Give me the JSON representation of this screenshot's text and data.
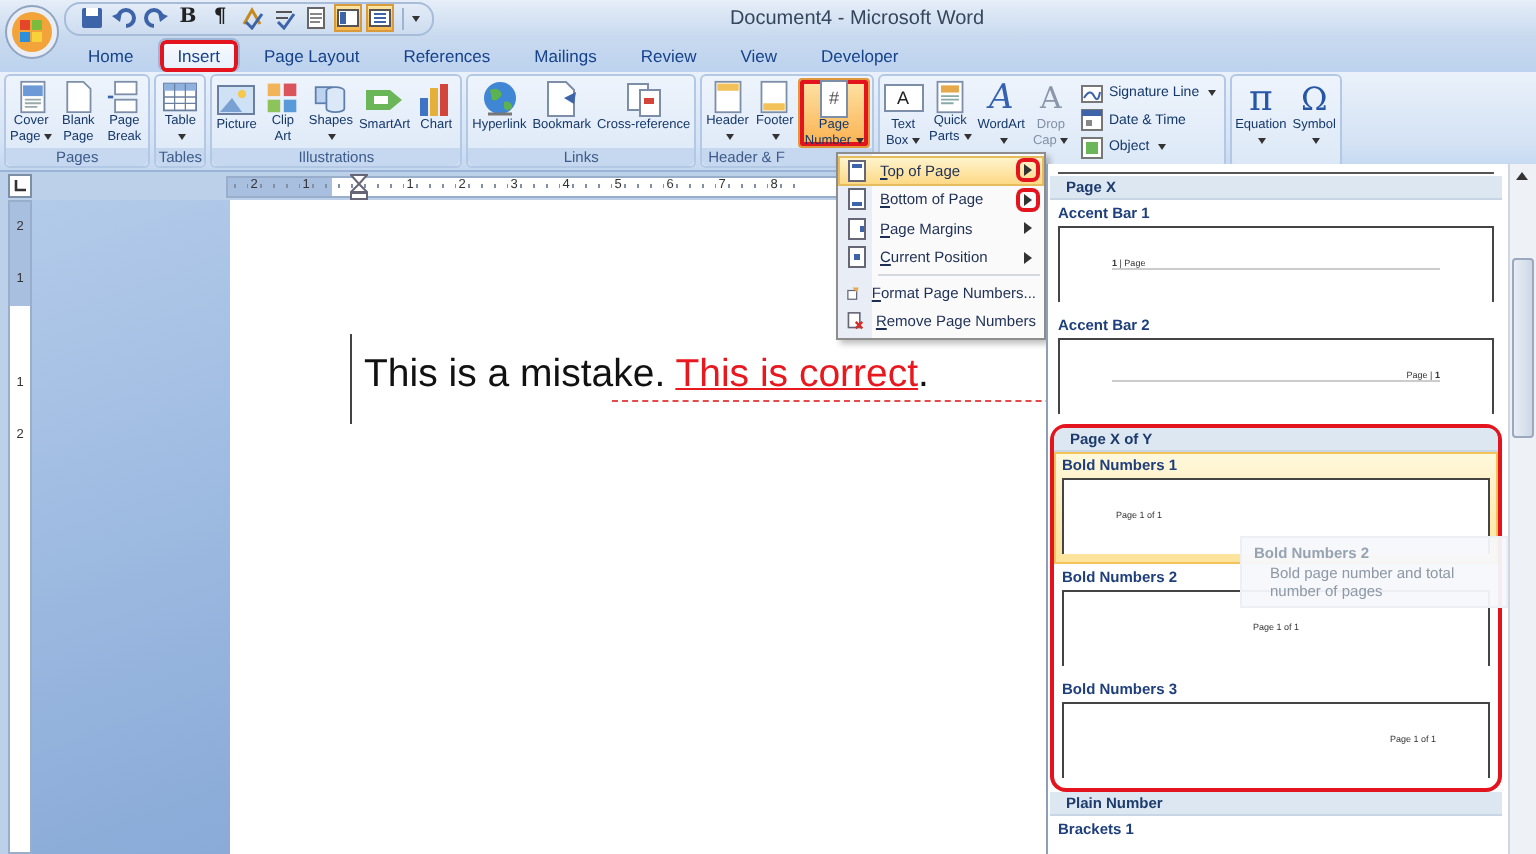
{
  "window": {
    "title": "Document4 - Microsoft Word"
  },
  "quick_access": [
    {
      "pressed": false
    },
    {
      "pressed": false
    },
    {
      "pressed": false
    },
    {
      "glyph": "B",
      "pressed": false
    },
    {
      "glyph": "¶",
      "pressed": false
    },
    {
      "pressed": false
    },
    {
      "pressed": false
    },
    {
      "pressed": false
    },
    {
      "pressed": true
    },
    {
      "pressed": true
    }
  ],
  "tabs": [
    {
      "label": "Home",
      "selected": false,
      "highlighted": false
    },
    {
      "label": "Insert",
      "selected": true,
      "highlighted": true
    },
    {
      "label": "Page Layout",
      "selected": false,
      "highlighted": false
    },
    {
      "label": "References",
      "selected": false,
      "highlighted": false
    },
    {
      "label": "Mailings",
      "selected": false,
      "highlighted": false
    },
    {
      "label": "Review",
      "selected": false,
      "highlighted": false
    },
    {
      "label": "View",
      "selected": false,
      "highlighted": false
    },
    {
      "label": "Developer",
      "selected": false,
      "highlighted": false
    }
  ],
  "ribbon": {
    "groups": [
      {
        "label": "Pages",
        "buttons": [
          {
            "kind": "large",
            "label": "Cover\nPage",
            "dropdown": true,
            "selected": false,
            "disabled": false,
            "highlighted": false
          },
          {
            "kind": "large",
            "label": "Blank\nPage",
            "dropdown": false,
            "selected": false,
            "disabled": false,
            "highlighted": false
          },
          {
            "kind": "large",
            "label": "Page\nBreak",
            "dropdown": false,
            "selected": false,
            "disabled": false,
            "highlighted": false
          }
        ]
      },
      {
        "label": "Tables",
        "buttons": [
          {
            "kind": "large",
            "label": "Table",
            "dropdown": true,
            "selected": false,
            "disabled": false,
            "highlighted": false
          }
        ]
      },
      {
        "label": "Illustrations",
        "buttons": [
          {
            "kind": "large",
            "label": "Picture",
            "dropdown": false,
            "selected": false,
            "disabled": false,
            "highlighted": false
          },
          {
            "kind": "large",
            "label": "Clip\nArt",
            "dropdown": false,
            "selected": false,
            "disabled": false,
            "highlighted": false
          },
          {
            "kind": "large",
            "label": "Shapes",
            "dropdown": true,
            "selected": false,
            "disabled": false,
            "highlighted": false
          },
          {
            "kind": "large",
            "label": "SmartArt",
            "dropdown": false,
            "selected": false,
            "disabled": false,
            "highlighted": false
          },
          {
            "kind": "large",
            "label": "Chart",
            "dropdown": false,
            "selected": false,
            "disabled": false,
            "highlighted": false
          }
        ]
      },
      {
        "label": "Links",
        "buttons": [
          {
            "kind": "large",
            "label": "Hyperlink",
            "dropdown": false,
            "selected": false,
            "disabled": false,
            "highlighted": false
          },
          {
            "kind": "large",
            "label": "Bookmark",
            "dropdown": false,
            "selected": false,
            "disabled": false,
            "highlighted": false
          },
          {
            "kind": "large",
            "label": "Cross-reference",
            "dropdown": false,
            "selected": false,
            "disabled": false,
            "highlighted": false
          }
        ]
      },
      {
        "label": "Header & F",
        "buttons": [
          {
            "kind": "large",
            "label": "Header",
            "dropdown": true,
            "selected": false,
            "disabled": false,
            "highlighted": false
          },
          {
            "kind": "large",
            "label": "Footer",
            "dropdown": true,
            "selected": false,
            "disabled": false,
            "highlighted": false
          },
          {
            "kind": "large",
            "label": "Page\nNumber",
            "glyph": "#",
            "dropdown": true,
            "selected": true,
            "disabled": false,
            "highlighted": true
          }
        ]
      },
      {
        "buttons": [
          {
            "kind": "large",
            "label": "Text\nBox",
            "glyph": "A",
            "dropdown": true,
            "selected": false,
            "disabled": false,
            "highlighted": false
          },
          {
            "kind": "large",
            "label": "Quick\nParts",
            "dropdown": true,
            "selected": false,
            "disabled": false,
            "highlighted": false
          },
          {
            "kind": "large",
            "label": "WordArt",
            "glyph": "A",
            "dropdown": true,
            "selected": false,
            "disabled": false,
            "highlighted": false
          },
          {
            "kind": "large",
            "label": "Drop\nCap",
            "glyph": "A",
            "dropdown": true,
            "selected": false,
            "disabled": true,
            "highlighted": false
          },
          {
            "kind": "small",
            "label": "Signature Line",
            "dropdown": true,
            "selected": false,
            "disabled": false,
            "highlighted": false
          },
          {
            "kind": "small",
            "label": "Date & Time",
            "dropdown": false,
            "selected": false,
            "disabled": false,
            "highlighted": false
          },
          {
            "kind": "small",
            "label": "Object",
            "dropdown": true,
            "selected": false,
            "disabled": false,
            "highlighted": false
          }
        ]
      },
      {
        "buttons": [
          {
            "kind": "large",
            "label": "Equation",
            "glyph": "π",
            "dropdown": true,
            "selected": false,
            "disabled": false,
            "highlighted": false
          },
          {
            "kind": "large",
            "label": "Symbol",
            "glyph": "Ω",
            "dropdown": true,
            "selected": false,
            "disabled": false,
            "highlighted": false
          }
        ]
      }
    ]
  },
  "ruler": {
    "marks": [
      {
        "label": "2",
        "in_margin": true
      },
      {
        "label": "1",
        "in_margin": true
      },
      {
        "label": "1",
        "in_margin": false
      },
      {
        "label": "2",
        "in_margin": false
      },
      {
        "label": "3",
        "in_margin": false
      },
      {
        "label": "4",
        "in_margin": false
      },
      {
        "label": "5",
        "in_margin": false
      },
      {
        "label": "6",
        "in_margin": false
      },
      {
        "label": "7",
        "in_margin": false
      },
      {
        "label": "8",
        "in_margin": false
      }
    ]
  },
  "vertical_ruler": {
    "marks": [
      {
        "label": "2",
        "in_margin": true
      },
      {
        "label": "1",
        "in_margin": true
      },
      {
        "label": "1",
        "in_margin": false
      },
      {
        "label": "2",
        "in_margin": false
      }
    ]
  },
  "document": {
    "runs": [
      {
        "kind": "plain",
        "text": "This is a mistake. "
      },
      {
        "kind": "inserted",
        "text": "This is correct"
      },
      {
        "kind": "plain",
        "text": "."
      }
    ]
  },
  "page_number_menu": {
    "items": [
      {
        "kind": "submenu",
        "label": "Top of Page",
        "selected": true,
        "highlighted": true
      },
      {
        "kind": "submenu",
        "label": "Bottom of Page",
        "selected": false,
        "highlighted": true
      },
      {
        "kind": "submenu",
        "label": "Page Margins",
        "selected": false,
        "highlighted": false
      },
      {
        "kind": "submenu",
        "label": "Current Position",
        "selected": false,
        "highlighted": false
      },
      {
        "kind": "command",
        "label": "Format Page Numbers...",
        "selected": false,
        "highlighted": false
      },
      {
        "kind": "command",
        "label": "Remove Page Numbers",
        "selected": false,
        "highlighted": false
      }
    ]
  },
  "gallery": {
    "sections": [
      {
        "title": "Page X",
        "highlighted": false,
        "items": [
          {
            "label": "Accent Bar 1",
            "sample": "**1** | Page",
            "kind": "left",
            "rule": true,
            "selected": false
          },
          {
            "label": "Accent Bar 2",
            "sample": "Page | **1**",
            "kind": "right",
            "rule": true,
            "selected": false
          }
        ]
      },
      {
        "title": "Page X of Y",
        "highlighted": true,
        "items": [
          {
            "label": "Bold Numbers 1",
            "sample": "Page 1 of 1",
            "kind": "left",
            "rule": false,
            "selected": true
          },
          {
            "label": "Bold Numbers 2",
            "sample": "Page 1 of 1",
            "kind": "center",
            "rule": false,
            "selected": false,
            "tooltip": {
              "title": "Bold Numbers 2",
              "text": "Bold page number and total number of pages"
            }
          },
          {
            "label": "Bold Numbers 3",
            "sample": "Page 1 of 1",
            "kind": "right",
            "rule": false,
            "selected": false
          }
        ]
      },
      {
        "title": "Plain Number",
        "highlighted": false,
        "items": [
          {
            "label": "Brackets 1",
            "selected": false
          }
        ]
      }
    ]
  }
}
